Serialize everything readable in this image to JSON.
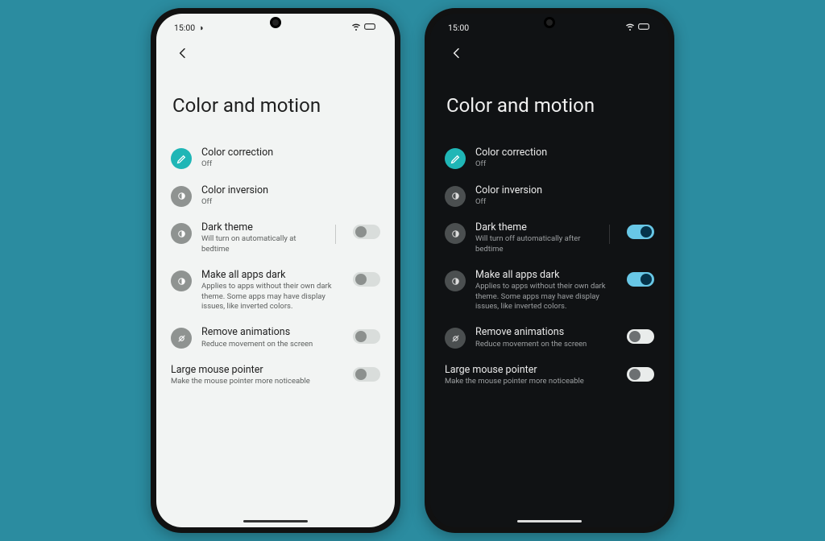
{
  "status": {
    "time": "15:00",
    "wifi": "wifi-icon",
    "battery": "battery-icon",
    "dnd": "dnd-icon"
  },
  "page_title": "Color and motion",
  "light": {
    "items": {
      "color_correction": {
        "title": "Color correction",
        "sub": "Off"
      },
      "color_inversion": {
        "title": "Color inversion",
        "sub": "Off"
      },
      "dark_theme": {
        "title": "Dark theme",
        "sub": "Will turn on automatically at bedtime"
      },
      "make_dark": {
        "title": "Make all apps dark",
        "sub": "Applies to apps without their own dark theme. Some apps may have display issues, like inverted colors."
      },
      "remove_anim": {
        "title": "Remove animations",
        "sub": "Reduce movement on the screen"
      },
      "large_pointer": {
        "title": "Large mouse pointer",
        "sub": "Make the mouse pointer more noticeable"
      }
    },
    "switches": {
      "dark_theme": false,
      "make_dark": false,
      "remove_anim": false,
      "large_pointer": false
    }
  },
  "dark": {
    "items": {
      "color_correction": {
        "title": "Color correction",
        "sub": "Off"
      },
      "color_inversion": {
        "title": "Color inversion",
        "sub": "Off"
      },
      "dark_theme": {
        "title": "Dark theme",
        "sub": "Will turn off automatically after bedtime"
      },
      "make_dark": {
        "title": "Make all apps dark",
        "sub": "Applies to apps without their own dark theme. Some apps may have display issues, like inverted colors."
      },
      "remove_anim": {
        "title": "Remove animations",
        "sub": "Reduce movement on the screen"
      },
      "large_pointer": {
        "title": "Large mouse pointer",
        "sub": "Make the mouse pointer more noticeable"
      }
    },
    "switches": {
      "dark_theme": true,
      "make_dark": true,
      "remove_anim": false,
      "large_pointer": false
    }
  },
  "colors": {
    "accent_teal": "#1fb6b6",
    "switch_on_bg": "#68c7e6"
  }
}
